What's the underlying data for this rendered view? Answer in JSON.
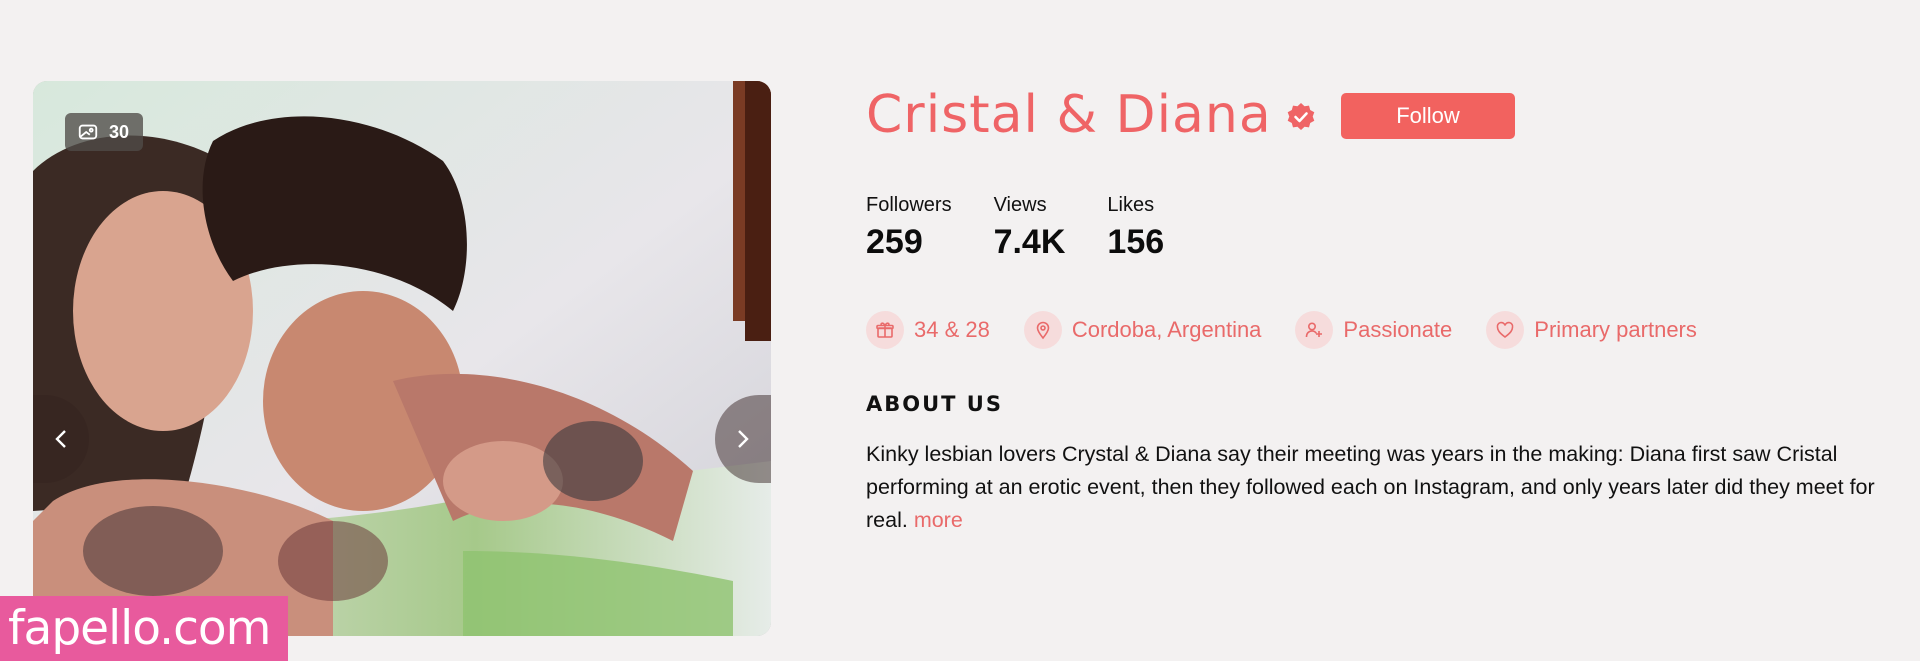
{
  "photo": {
    "count": "30",
    "count_icon": "photo-stack-icon",
    "prev_icon": "chevron-left-icon",
    "next_icon": "chevron-right-icon"
  },
  "watermark": {
    "text": "fapello.com"
  },
  "profile": {
    "name": "Cristal & Diana",
    "verified_icon": "verified-badge-icon",
    "follow_label": "Follow",
    "stats": [
      {
        "label": "Followers",
        "value": "259"
      },
      {
        "label": "Views",
        "value": "7.4K"
      },
      {
        "label": "Likes",
        "value": "156"
      }
    ],
    "tags": [
      {
        "icon": "gift-icon",
        "text": "34 & 28"
      },
      {
        "icon": "location-pin-icon",
        "text": "Cordoba, Argentina"
      },
      {
        "icon": "user-plus-icon",
        "text": "Passionate"
      },
      {
        "icon": "heart-icon",
        "text": "Primary partners"
      }
    ],
    "about_heading": "ABOUT US",
    "about_text": "Kinky lesbian lovers Crystal & Diana say their meeting was years in the making: Diana first saw Cristal performing at an erotic event, then they followed each on Instagram, and only years later did they meet for real.",
    "more_label": "more"
  },
  "colors": {
    "accent": "#ef6466",
    "background": "#f3f1f1",
    "watermark": "#e85a9d",
    "tag_bg": "#f6dcdc"
  }
}
